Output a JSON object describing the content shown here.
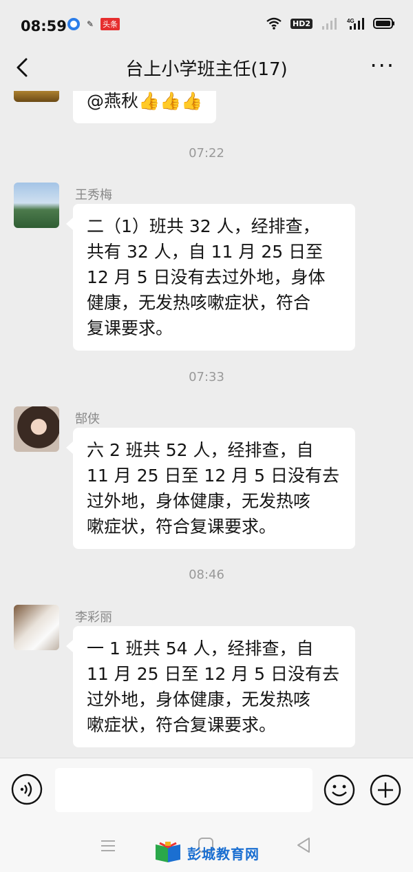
{
  "status_bar": {
    "time": "08:59",
    "app_badge": "头条",
    "hd_label": "HD2",
    "network_label": "4G"
  },
  "header": {
    "title": "台上小学班主任(17)"
  },
  "messages": [
    {
      "type": "partial",
      "text": "@燕秋👍👍👍"
    },
    {
      "type": "time",
      "text": "07:22"
    },
    {
      "type": "message",
      "sender": "王秀梅",
      "lines": [
        "二（1）班共 32 人，经排查，",
        "共有 32 人，自 11 月 25 日至",
        "12 月 5 日没有去过外地，身体",
        "健康，无发热咳嗽症状，符合",
        "复课要求。"
      ]
    },
    {
      "type": "time",
      "text": "07:33"
    },
    {
      "type": "message",
      "sender": "郜侠",
      "lines": [
        "六 2 班共 52 人，经排查，自",
        "11 月 25 日至 12 月 5 日没有去",
        "过外地，身体健康，无发热咳",
        "嗽症状，符合复课要求。"
      ]
    },
    {
      "type": "time",
      "text": "08:46"
    },
    {
      "type": "message",
      "sender": "李彩丽",
      "lines": [
        "一 1 班共 54 人，经排查，自",
        "11 月 25 日至 12 月 5 日没有去",
        "过外地，身体健康，无发热咳",
        "嗽症状，符合复课要求。"
      ]
    }
  ],
  "input": {
    "value": "",
    "placeholder": ""
  },
  "watermark": "彭城教育网"
}
